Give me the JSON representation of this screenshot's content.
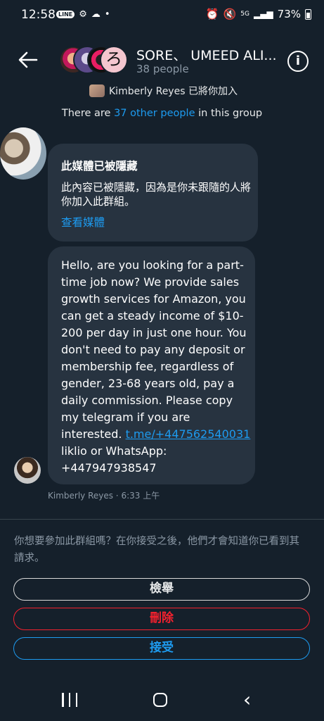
{
  "status_bar": {
    "time": "12:58",
    "battery": "73%",
    "network": "5G"
  },
  "header": {
    "title": "SORE、 UMEED ALI...",
    "subtitle": "38 people",
    "added_by_text": "Kimberly Reyes 已將你加入"
  },
  "group_info": {
    "prefix": "There are ",
    "link": "37 other people",
    "suffix": " in this group"
  },
  "messages": {
    "hidden_media": {
      "title": "此媒體已被隱藏",
      "body": "此內容已被隱藏，因為是你未跟隨的人將你加入此群組。",
      "action": "查看媒體"
    },
    "text_message": {
      "body_before_link": "Hello, are you looking for a part-time job now? We provide sales growth services for Amazon, you can get a steady income of $10-200 per day in just one hour. You don't need to pay any deposit or membership fee, regardless of gender, 23-68 years old, pay a daily commission. Please copy my telegram if you are interested. ",
      "link": "t.me/+447562540031",
      "body_after_link": " liklio   or WhatsApp:  +447947938547"
    },
    "meta": "Kimberly Reyes · 6:33 上午"
  },
  "join_request": {
    "prompt": "你想要參加此群組嗎？在你接受之後，他們才會知道你已看到其請求。",
    "report_label": "檢舉",
    "delete_label": "刪除",
    "accept_label": "接受"
  },
  "colors": {
    "background": "#15202b",
    "bubble": "#273340",
    "accent": "#1d9bf0",
    "danger": "#f4212e"
  }
}
